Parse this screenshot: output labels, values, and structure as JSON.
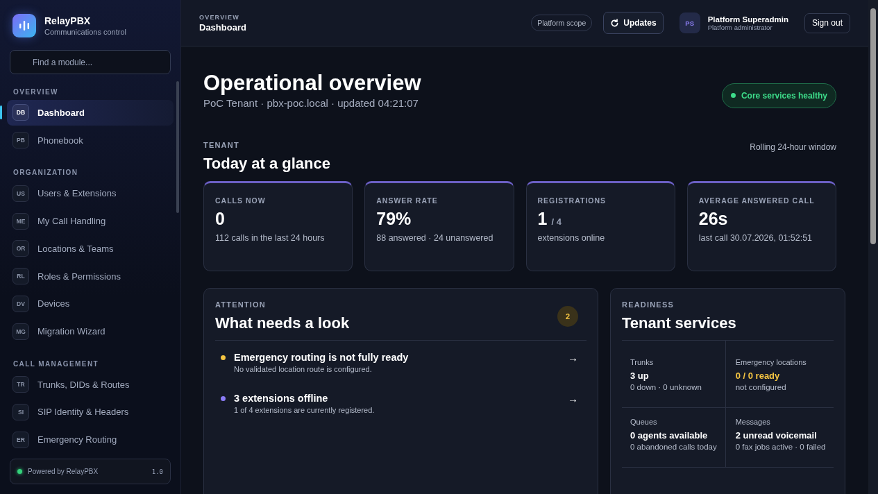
{
  "brand": {
    "name": "RelayPBX",
    "tagline": "Communications control"
  },
  "sidebar": {
    "search": {
      "placeholder": "Find a module..."
    },
    "sections": [
      {
        "title": "OVERVIEW",
        "items": [
          {
            "code": "DB",
            "label": "Dashboard",
            "selected": true
          },
          {
            "code": "PB",
            "label": "Phonebook",
            "selected": false
          }
        ]
      },
      {
        "title": "ORGANIZATION",
        "items": [
          {
            "code": "US",
            "label": "Users & Extensions",
            "selected": false
          },
          {
            "code": "ME",
            "label": "My Call Handling",
            "selected": false
          },
          {
            "code": "OR",
            "label": "Locations & Teams",
            "selected": false
          },
          {
            "code": "RL",
            "label": "Roles & Permissions",
            "selected": false
          },
          {
            "code": "DV",
            "label": "Devices",
            "selected": false
          },
          {
            "code": "MG",
            "label": "Migration Wizard",
            "selected": false
          }
        ]
      },
      {
        "title": "CALL MANAGEMENT",
        "items": [
          {
            "code": "TR",
            "label": "Trunks, DIDs & Routes",
            "selected": false
          },
          {
            "code": "SI",
            "label": "SIP Identity & Headers",
            "selected": false
          },
          {
            "code": "ER",
            "label": "Emergency Routing",
            "selected": false
          }
        ]
      }
    ],
    "footer": {
      "label": "Powered by RelayPBX",
      "version": "1.0",
      "online": true
    }
  },
  "header": {
    "eyebrow": "OVERVIEW",
    "title": "Dashboard",
    "scope": "Platform scope",
    "updates": "Updates",
    "user": {
      "initials": "PS",
      "name": "Platform Superadmin",
      "role": "Platform administrator"
    },
    "sign_out": "Sign out"
  },
  "hero": {
    "title": "Operational overview",
    "subtitle": "PoC Tenant · pbx-poc.local · updated 04:21:07",
    "status": {
      "label": "Core services healthy",
      "healthy": true
    }
  },
  "glance": {
    "eyebrow": "TENANT",
    "title": "Today at a glance",
    "note": "Rolling 24-hour window",
    "stats": [
      {
        "label": "CALLS NOW",
        "value": "0",
        "detail": "112 calls in the last 24 hours"
      },
      {
        "label": "ANSWER RATE",
        "value": "79%",
        "detail": "88 answered · 24 unanswered"
      },
      {
        "label": "REGISTRATIONS",
        "value": "1",
        "suffix": "/ 4",
        "detail": "extensions online"
      },
      {
        "label": "AVERAGE ANSWERED CALL",
        "value": "26s",
        "detail": "last call 30.07.2026, 01:52:51"
      }
    ]
  },
  "attention": {
    "eyebrow": "ATTENTION",
    "title": "What needs a look",
    "count": "2",
    "items": [
      {
        "title": "Emergency routing is not fully ready",
        "detail": "No validated location route is configured.",
        "color": "#f5c542",
        "arrow": "→"
      },
      {
        "title": "3 extensions offline",
        "detail": "1 of 4 extensions are currently registered.",
        "color": "#8b7cf6",
        "arrow": "→"
      }
    ]
  },
  "readiness": {
    "eyebrow": "READINESS",
    "title": "Tenant services",
    "items": [
      {
        "label": "Trunks",
        "value": "3 up",
        "detail": "0 down · 0 unknown",
        "warning": false
      },
      {
        "label": "Emergency locations",
        "value": "0 / 0 ready",
        "detail": "not configured",
        "warning": true
      },
      {
        "label": "Queues",
        "value": "0 agents available",
        "detail": "0 abandoned calls today",
        "warning": false
      },
      {
        "label": "Messages",
        "value": "2 unread voicemail",
        "detail": "0 fax jobs active · 0 failed",
        "warning": false
      }
    ]
  }
}
